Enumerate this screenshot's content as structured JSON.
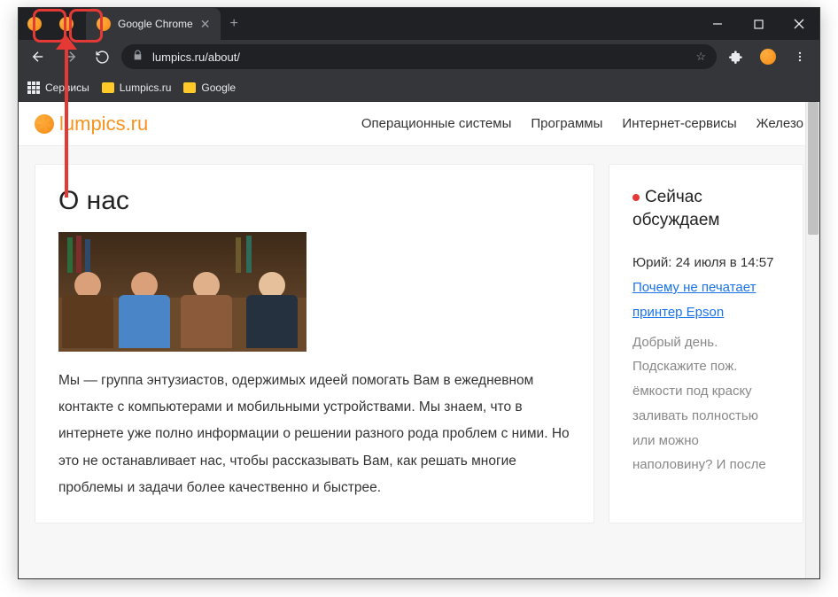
{
  "browser": {
    "tab_title": "Google Chrome",
    "url": "lumpics.ru/about/",
    "bookmarks_bar": {
      "services": "Сервисы",
      "items": [
        "Lumpics.ru",
        "Google"
      ]
    }
  },
  "site": {
    "logo_text": "lumpics.ru",
    "nav": [
      "Операционные системы",
      "Программы",
      "Интернет-сервисы",
      "Железо"
    ]
  },
  "main": {
    "heading": "О нас",
    "paragraph": "Мы — группа энтузиастов, одержимых идеей помогать Вам в ежедневном контакте с компьютерами и мобильными устройствами. Мы знаем, что в интернете уже полно информации о решении разного рода проблем с ними. Но это не останавливает нас, чтобы рассказывать Вам, как решать многие проблемы и задачи более качественно и быстрее."
  },
  "sidebar": {
    "heading": "Сейчас обсуждаем",
    "comment": {
      "author": "Юрий:",
      "when": "24 июля в 14:57",
      "link": "Почему не печатает принтер Epson",
      "body": "Добрый день. Подскажите пож. ёмкости под краску заливать полностью или можно наполовину? И после"
    }
  }
}
